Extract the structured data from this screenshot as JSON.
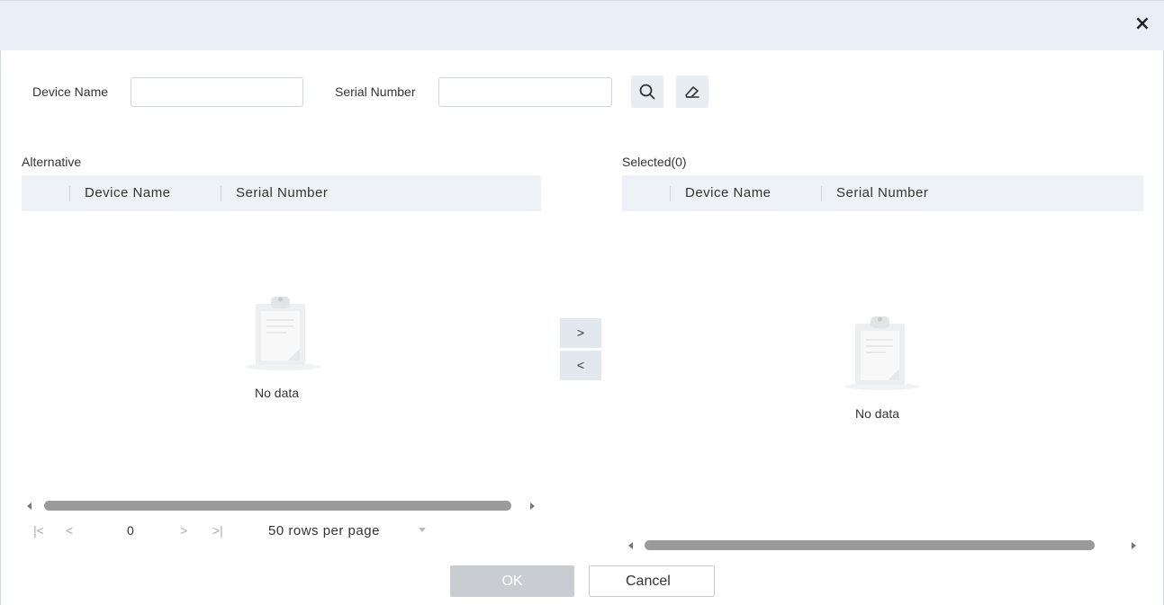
{
  "dialog": {
    "close_glyph": "×"
  },
  "search": {
    "device_name_label": "Device Name",
    "device_name_value": "",
    "serial_number_label": "Serial Number",
    "serial_number_value": "",
    "search_icon": "search-icon",
    "clear_icon": "eraser-icon"
  },
  "alternative": {
    "title": "Alternative",
    "columns": [
      "Device Name",
      "Serial Number"
    ],
    "empty_text": "No data",
    "pager": {
      "first": "|<",
      "prev": "<",
      "page": "0",
      "next": ">",
      "last": ">|",
      "rows_per_page": "50 rows per page"
    }
  },
  "transfer": {
    "add_label": ">",
    "remove_label": "<"
  },
  "selected": {
    "title": "Selected(0)",
    "columns": [
      "Device Name",
      "Serial Number"
    ],
    "empty_text": "No data"
  },
  "footer": {
    "ok_label": "OK",
    "cancel_label": "Cancel"
  },
  "colors": {
    "header_bg": "#e9eff6",
    "grid_header_bg": "#eef2f6",
    "ok_disabled": "#c9cdd2"
  }
}
